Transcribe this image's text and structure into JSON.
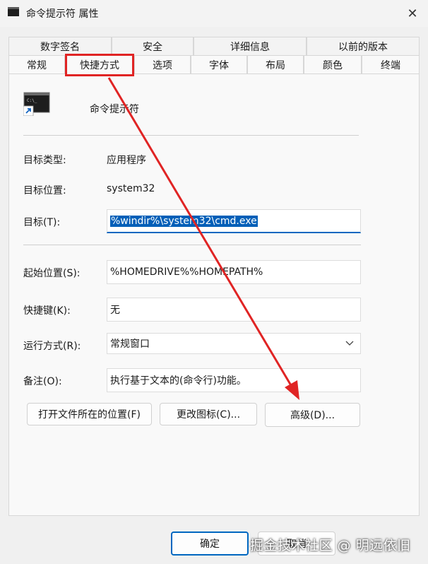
{
  "window": {
    "title": "命令提示符 属性",
    "close_glyph": "✕"
  },
  "tabs_row1": [
    "数字签名",
    "安全",
    "详细信息",
    "以前的版本"
  ],
  "tabs_row2": [
    "常规",
    "快捷方式",
    "选项",
    "字体",
    "布局",
    "颜色",
    "终端"
  ],
  "active_tab": "快捷方式",
  "header": {
    "app_name": "命令提示符",
    "icon": "cmd-shortcut-icon"
  },
  "fields": {
    "target_type_label": "目标类型:",
    "target_type_value": "应用程序",
    "target_location_label": "目标位置:",
    "target_location_value": "system32",
    "target_label": "目标(T):",
    "target_value": "%windir%\\system32\\cmd.exe",
    "start_in_label": "起始位置(S):",
    "start_in_value": "%HOMEDRIVE%%HOMEPATH%",
    "hotkey_label": "快捷键(K):",
    "hotkey_value": "无",
    "run_label": "运行方式(R):",
    "run_value": "常规窗口",
    "comment_label": "备注(O):",
    "comment_value": "执行基于文本的(命令行)功能。"
  },
  "buttons": {
    "open_location": "打开文件所在的位置(F)",
    "change_icon": "更改图标(C)...",
    "advanced": "高级(D)...",
    "ok": "确定",
    "cancel": "取消"
  },
  "watermark": "掘金技术社区 @ 明远依旧",
  "colors": {
    "annotation": "#e02424",
    "accent": "#0067c0",
    "selection": "#005fb8"
  }
}
